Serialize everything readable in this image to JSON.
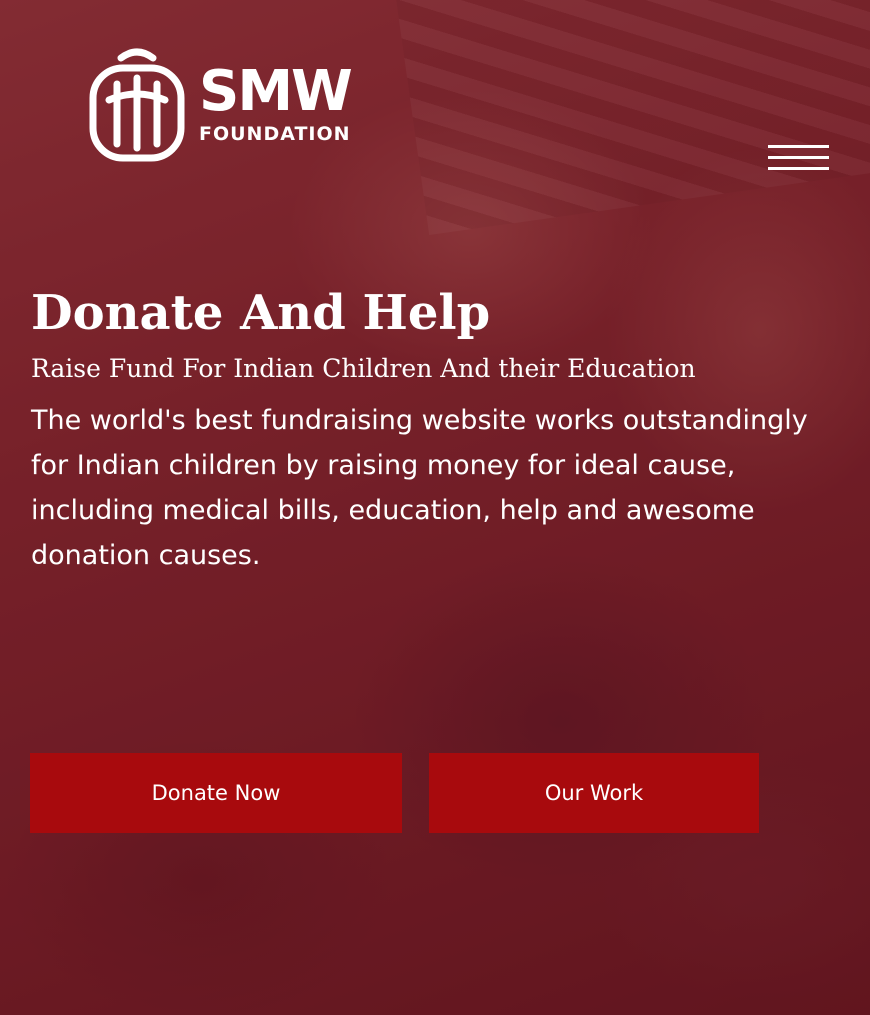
{
  "header": {
    "logo_title": "SMW",
    "logo_subtitle": "FOUNDATION",
    "menu_icon": "hamburger-menu-icon"
  },
  "hero": {
    "headline": "Donate And Help",
    "subheadline": "Raise Fund For Indian Children And their Education",
    "description": "The world's best fundraising website works outstandingly for Indian children by raising money for ideal cause, including medical bills, education, help and awesome donation causes.",
    "primary_button": "Donate Now",
    "secondary_button": "Our Work"
  },
  "colors": {
    "overlay": "#7a2129",
    "button": "#a80a0d",
    "text": "#ffffff"
  }
}
